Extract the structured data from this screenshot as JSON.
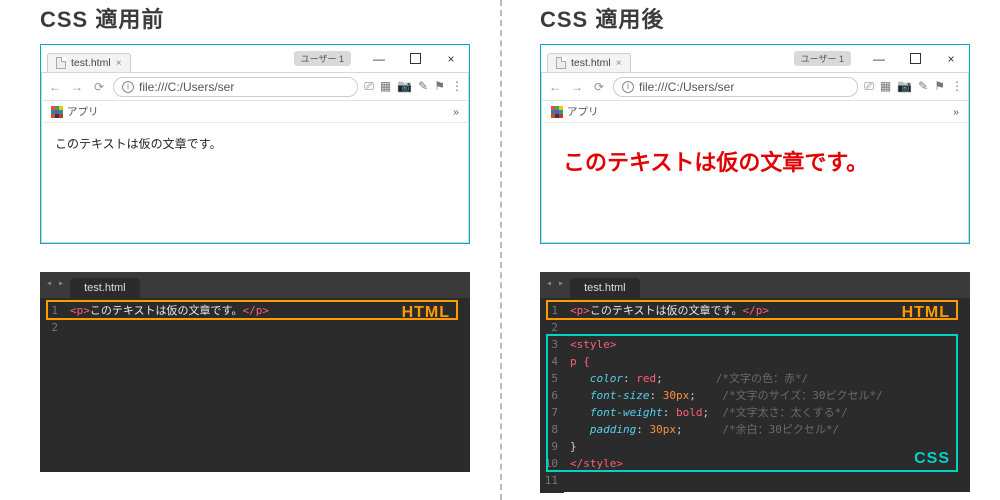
{
  "headings": {
    "before": "CSS 適用前",
    "after": "CSS 適用後"
  },
  "browser": {
    "tab_title": "test.html",
    "user_badge": "ユーザー 1",
    "url": "file:///C:/Users/ser",
    "bookmarks_label": "アプリ",
    "overflow_glyph": "»",
    "win": {
      "minimize": "—",
      "close": "×"
    },
    "nav": {
      "back": "←",
      "forward": "→",
      "reload": "⟳"
    },
    "icon_info": "i",
    "cast_glyph": "⎚",
    "qr_glyph": "▦",
    "camera_glyph": "📷",
    "picker_glyph": "✎",
    "flag_glyph": "⚑",
    "menu_glyph": "⋮"
  },
  "page_text": {
    "plain": "このテキストは仮の文章です。",
    "styled": "このテキストは仮の文章です。"
  },
  "editor": {
    "tab_title": "test.html",
    "nav_glyph": "◂ ▸",
    "html_label": "HTML",
    "css_label": "CSS",
    "code_html": {
      "open": "<p>",
      "text": "このテキストは仮の文章です。",
      "close": "</p>"
    },
    "code_css": {
      "l3": "<style>",
      "l4": "p {",
      "l5_prop": "color",
      "l5_val": "red",
      "l5_cmt": "/*文字の色：赤*/",
      "l6_prop": "font-size",
      "l6_val": "30px",
      "l6_cmt": "/*文字のサイズ：30ピクセル*/",
      "l7_prop": "font-weight",
      "l7_val": "bold",
      "l7_cmt": "/*文字太さ：太くする*/",
      "l8_prop": "padding",
      "l8_val": "30px",
      "l8_cmt": "/*余白：30ピクセル*/",
      "l9": "}",
      "l10": "</style>"
    }
  }
}
